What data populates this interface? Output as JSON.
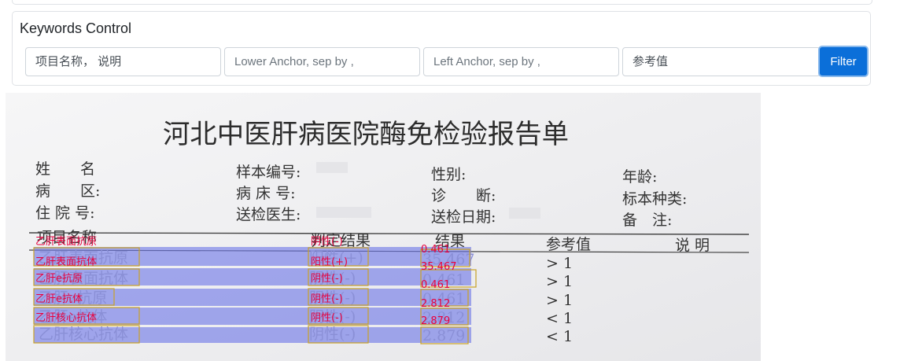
{
  "keywords_control": {
    "title": "Keywords Control",
    "inputs": [
      {
        "placeholder": "项目名称， 说明"
      },
      {
        "placeholder": "Lower Anchor, sep by ,"
      },
      {
        "placeholder": "Left Anchor, sep by ,"
      },
      {
        "placeholder": "参考值"
      }
    ],
    "filter_label": "Filter"
  },
  "report": {
    "title": "河北中医肝病医院酶免检验报告单",
    "header_fields": [
      {
        "label": "姓　　名"
      },
      {
        "label": "病　　区:"
      },
      {
        "label": "住 院 号:"
      },
      {
        "label": "样本编号:"
      },
      {
        "label": "病 床 号:"
      },
      {
        "label": "送检医生:"
      },
      {
        "label": "性别:"
      },
      {
        "label": "诊　　断:"
      },
      {
        "label": "送检日期:"
      },
      {
        "label": "年龄:"
      },
      {
        "label": "标本种类:"
      },
      {
        "label": "备　注:"
      }
    ],
    "table_headers": [
      "项目名称",
      "判定结果",
      "结果",
      "参考值",
      "说 明"
    ],
    "rows": [
      {
        "name": "乙肝表面抗原",
        "judge": "阳性(+)",
        "result": "35.467",
        "ref": "> 1"
      },
      {
        "name": "乙肝表面抗体",
        "judge": "阴性(-)",
        "result": "0.461",
        "ref": "> 1"
      },
      {
        "name": "乙肝e抗原",
        "judge": "阴性(-)",
        "result": "0.461",
        "ref": "> 1"
      },
      {
        "name": "乙肝e抗体",
        "judge": "阴性(-)",
        "result": "2.812",
        "ref": "< 1"
      },
      {
        "name": "乙肝核心抗体",
        "judge": "阴性(-)",
        "result": "2.879",
        "ref": "< 1"
      }
    ],
    "annotations": {
      "header": {
        "name": "乙肝表面抗原",
        "judge": "阴性(-)",
        "result": "0.461"
      },
      "rows": [
        {
          "name": "乙肝表面抗体",
          "judge": "阳性(+)",
          "result": "35.467"
        },
        {
          "name": "乙肝e抗原",
          "judge": "阴性(-)",
          "result": "0.461"
        },
        {
          "name": "乙肝e抗体",
          "judge": "阴性(-)",
          "result": "2.812"
        },
        {
          "name": "乙肝核心抗体",
          "judge": "阴性(-)",
          "result": "2.879"
        }
      ]
    },
    "colors": {
      "highlight": "#6f78e8",
      "box": "#c9a227",
      "annotation": "#e8003d",
      "paper": "#f1f1f3",
      "ink": "#333333"
    }
  }
}
